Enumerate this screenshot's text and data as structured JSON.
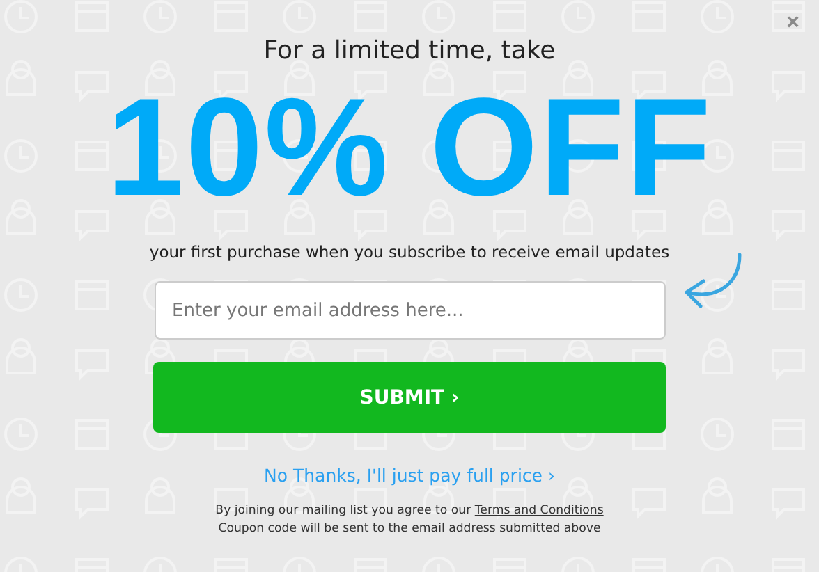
{
  "close": "×",
  "heading": "For a limited time, take",
  "offer": "10% OFF",
  "subtitle": "your first purchase when you subscribe to receive email updates",
  "email": {
    "placeholder": "Enter your email address here..."
  },
  "submit": "SUBMIT ›",
  "decline_link": "No Thanks, I'll just pay full price ›",
  "fine_print": {
    "text": "By joining our mailing list you agree to our",
    "link": "Terms and Conditions",
    "note": "Coupon code will be sent to the email address submitted above"
  }
}
